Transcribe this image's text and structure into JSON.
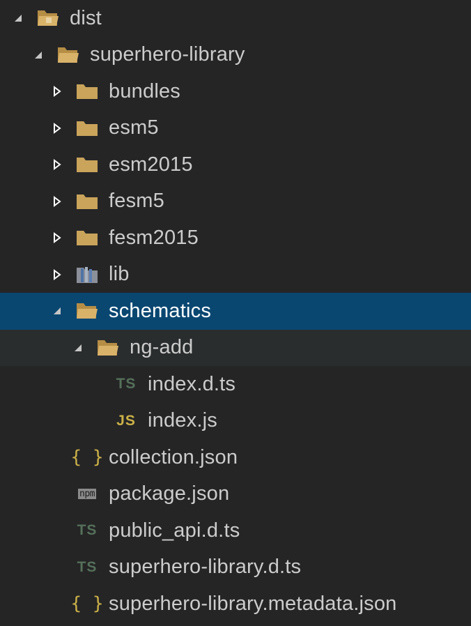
{
  "tree": {
    "items": [
      {
        "label": "dist",
        "depth": 0,
        "type": "folder",
        "expanded": true
      },
      {
        "label": "superhero-library",
        "depth": 1,
        "type": "folder",
        "expanded": true
      },
      {
        "label": "bundles",
        "depth": 2,
        "type": "folder",
        "expanded": false
      },
      {
        "label": "esm5",
        "depth": 2,
        "type": "folder",
        "expanded": false
      },
      {
        "label": "esm2015",
        "depth": 2,
        "type": "folder",
        "expanded": false
      },
      {
        "label": "fesm5",
        "depth": 2,
        "type": "folder",
        "expanded": false
      },
      {
        "label": "fesm2015",
        "depth": 2,
        "type": "folder",
        "expanded": false
      },
      {
        "label": "lib",
        "depth": 2,
        "type": "folder",
        "expanded": false
      },
      {
        "label": "schematics",
        "depth": 2,
        "type": "folder",
        "expanded": true,
        "selected": true
      },
      {
        "label": "ng-add",
        "depth": 3,
        "type": "folder",
        "expanded": true,
        "hover": true
      },
      {
        "label": "index.d.ts",
        "depth": 4,
        "type": "ts"
      },
      {
        "label": "index.js",
        "depth": 4,
        "type": "js"
      },
      {
        "label": "collection.json",
        "depth": 2,
        "type": "json"
      },
      {
        "label": "package.json",
        "depth": 2,
        "type": "npm"
      },
      {
        "label": "public_api.d.ts",
        "depth": 2,
        "type": "ts"
      },
      {
        "label": "superhero-library.d.ts",
        "depth": 2,
        "type": "ts"
      },
      {
        "label": "superhero-library.metadata.json",
        "depth": 2,
        "type": "json"
      }
    ],
    "icon_text": {
      "ts": "TS",
      "js": "JS",
      "json": "{ }",
      "npm": "npm"
    },
    "colors": {
      "background": "#252526",
      "selected": "#094771",
      "hover": "#2a2d2e",
      "folder": "#c9a45a",
      "text": "#cccccc"
    }
  }
}
